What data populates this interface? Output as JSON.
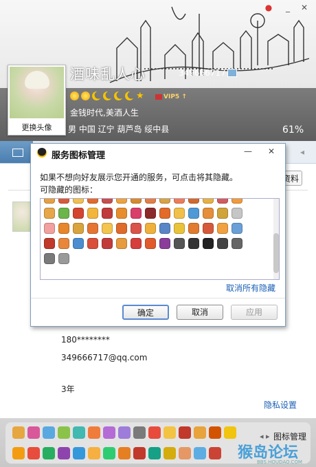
{
  "header": {
    "nickname": "酒味乱人心",
    "qq_number": "349666717",
    "avatar_label": "更换头像",
    "vip_label": "VIP5",
    "signature": "金钱时代,美酒人生",
    "user_info": "男   中国 辽宁 葫芦岛 绥中县",
    "percent": "61%",
    "level_icons": [
      "sun-icon",
      "sun-icon",
      "moon-icon",
      "moon-icon",
      "moon-icon",
      "moon-icon",
      "star-icon"
    ]
  },
  "main": {
    "edit_button": "资料",
    "phone": "180********",
    "email": "349666717@qq.com",
    "years": "3年",
    "privacy_link": "隐私设置"
  },
  "footer": {
    "label": "图标管理",
    "nav_prev": "◂",
    "nav_next": "▸"
  },
  "watermark": {
    "text": "猴岛论坛",
    "url": "BBS.HOUDAO.COM"
  },
  "dialog": {
    "title": "服务图标管理",
    "description": "如果不想向好友展示您开通的服务，可点击将其隐藏。",
    "sublabel": "可隐藏的图标：",
    "unhide_link": "取消所有隐藏",
    "ok": "确定",
    "cancel": "取消",
    "apply": "应用"
  },
  "colors": {
    "accent": "#1a5fb4",
    "header_band": "#6e6e6e",
    "tab_active": "#5a8ab8"
  }
}
